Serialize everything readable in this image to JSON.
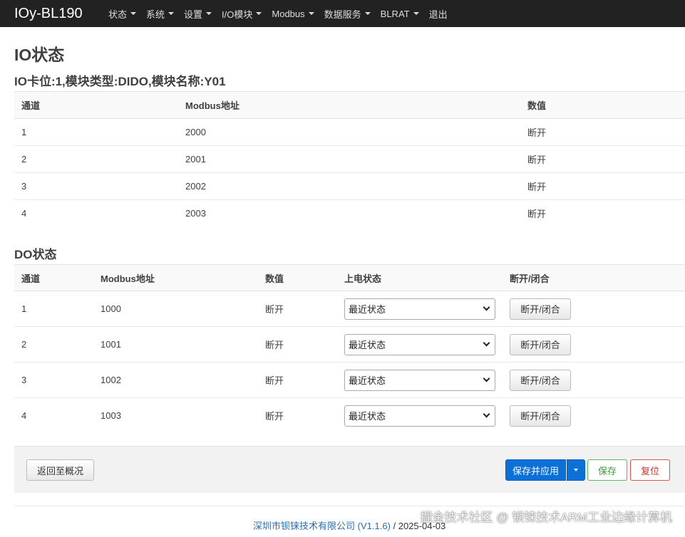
{
  "navbar": {
    "brand": "IOy-BL190",
    "items": [
      "状态",
      "系统",
      "设置",
      "I/O模块",
      "Modbus",
      "数据服务",
      "BLRAT",
      "退出"
    ]
  },
  "page_title": "IO状态",
  "io_section": {
    "title": "IO卡位:1,模块类型:DIDO,模块名称:Y01",
    "headers": [
      "通道",
      "Modbus地址",
      "数值"
    ],
    "rows": [
      [
        "1",
        "2000",
        "断开"
      ],
      [
        "2",
        "2001",
        "断开"
      ],
      [
        "3",
        "2002",
        "断开"
      ],
      [
        "4",
        "2003",
        "断开"
      ]
    ]
  },
  "do_section": {
    "title": "DO状态",
    "headers": [
      "通道",
      "Modbus地址",
      "数值",
      "上电状态",
      "断开/闭合"
    ],
    "rows": [
      {
        "channel": "1",
        "address": "1000",
        "value": "断开",
        "power_on": "最近状态",
        "toggle": "断开/闭合"
      },
      {
        "channel": "2",
        "address": "1001",
        "value": "断开",
        "power_on": "最近状态",
        "toggle": "断开/闭合"
      },
      {
        "channel": "3",
        "address": "1002",
        "value": "断开",
        "power_on": "最近状态",
        "toggle": "断开/闭合"
      },
      {
        "channel": "4",
        "address": "1003",
        "value": "断开",
        "power_on": "最近状态",
        "toggle": "断开/闭合"
      }
    ]
  },
  "actions": {
    "back": "返回至概况",
    "save_apply": "保存并应用",
    "save": "保存",
    "reset": "复位"
  },
  "footer": {
    "company": "深圳市钡铼技术有限公司",
    "version": "(V1.1.6)",
    "separator": " / ",
    "date": "2025-04-03"
  },
  "watermark": "掘金技术社区 @ 钡铼技术ARM工业边缘计算机",
  "colors": {
    "navbar": "#222222",
    "primary": "#0d6fd8",
    "success": "#5cb85c",
    "danger": "#d9534f"
  }
}
